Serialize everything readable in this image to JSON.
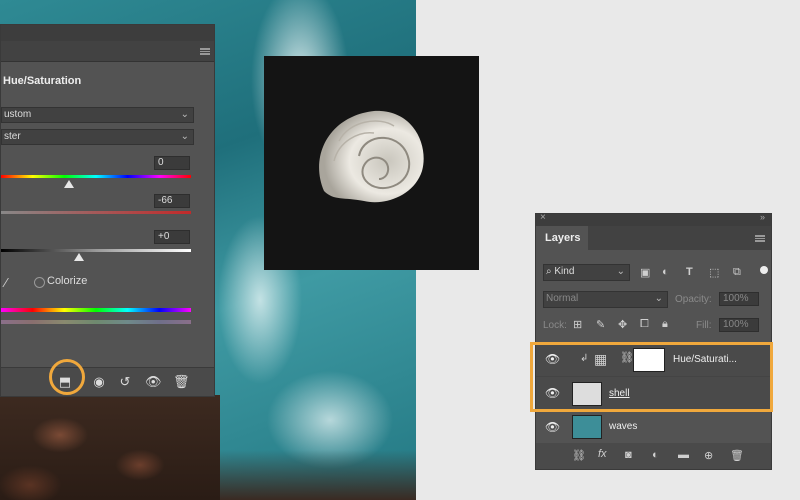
{
  "hue_saturation": {
    "title": "Hue/Saturation",
    "preset_value": "ustom",
    "channel_value": "ster",
    "hue_value": "0",
    "saturation_value": "-66",
    "lightness_value": "+0",
    "colorize_label": "Colorize"
  },
  "layers": {
    "tab_label": "Layers",
    "filter_kind": "Kind",
    "blend_mode": "Normal",
    "opacity_label": "Opacity:",
    "opacity_value": "100%",
    "lock_label": "Lock:",
    "fill_label": "Fill:",
    "fill_value": "100%",
    "items": [
      {
        "name": "Hue/Saturati..."
      },
      {
        "name": "shell"
      },
      {
        "name": "waves"
      }
    ]
  },
  "colors": {
    "highlight": "#f0a83c",
    "panel": "#535353"
  }
}
